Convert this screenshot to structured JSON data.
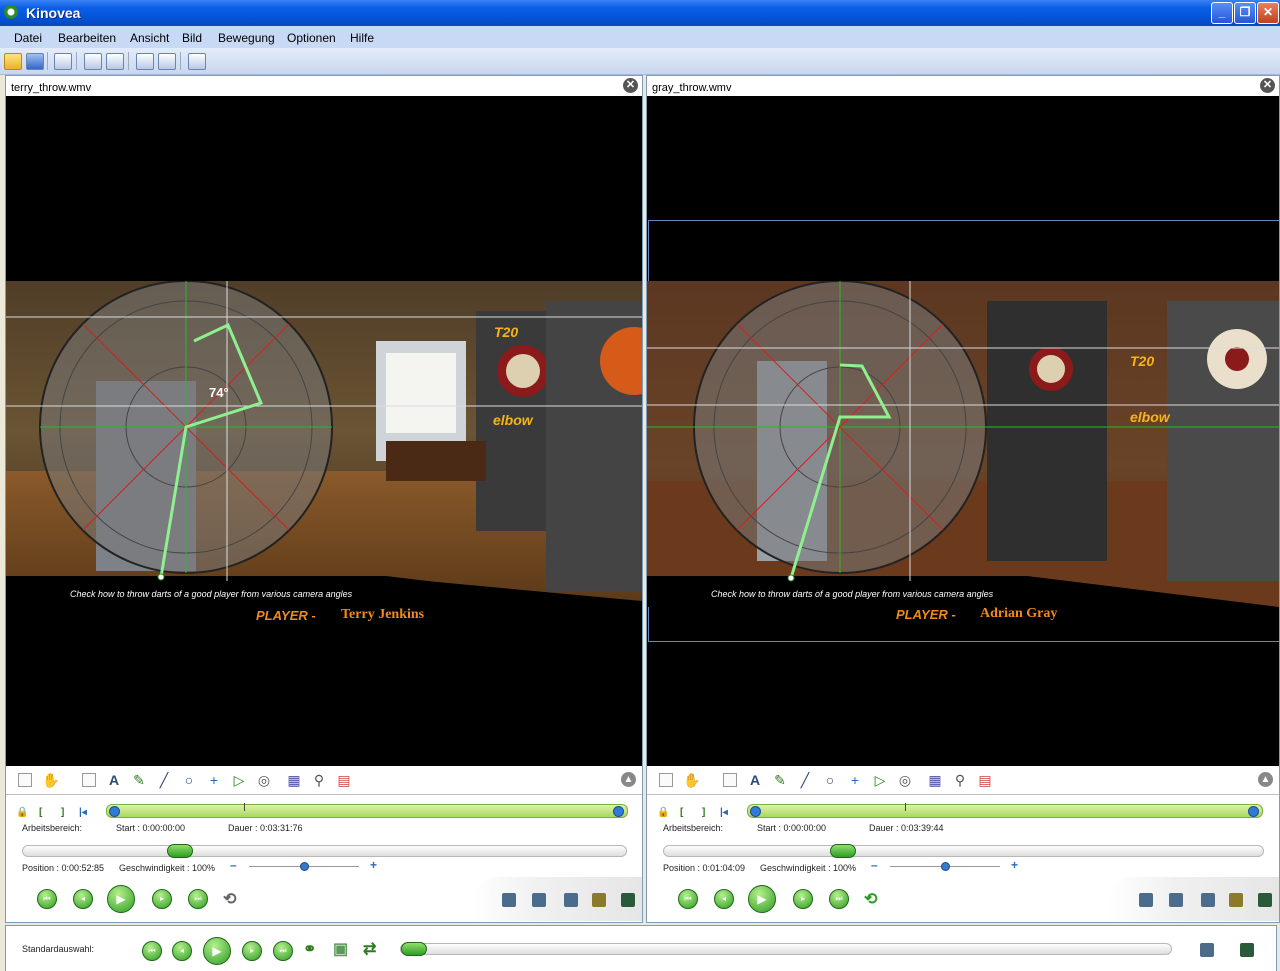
{
  "window": {
    "title": "Kinovea",
    "min_label": "_",
    "max_label": "❐",
    "close_label": "✕"
  },
  "menu": [
    "Datei",
    "Bearbeiten",
    "Ansicht",
    "Bild",
    "Bewegung",
    "Optionen",
    "Hilfe"
  ],
  "toolbar_icons": [
    "open-folder-icon",
    "save-icon",
    "browser-icon",
    "single-player-icon",
    "dual-player-icon",
    "capture-icon",
    "dual-capture-icon",
    "swap-screens-icon"
  ],
  "players": [
    {
      "file_name": "terry_throw.wmv",
      "close_label": "✕",
      "video": {
        "caption": "Check how to throw darts of a good  player from various camera angles",
        "player_prefix": "PLAYER -",
        "player_name": "Terry Jenkins",
        "angle_label": "74°",
        "t20_label": "T20",
        "elbow_label": "elbow"
      },
      "workspace_label": "Arbeitsbereich:",
      "start": "Start : 0:00:00:00",
      "duration": "Dauer : 0:03:31:76",
      "position": "Position : 0:00:52:85",
      "speed": "Geschwindigkeit : 100%",
      "loop_active": false
    },
    {
      "file_name": "gray_throw.wmv",
      "close_label": "✕",
      "video": {
        "caption": "Check how to throw darts of a good  player from various camera angles",
        "player_prefix": "PLAYER -",
        "player_name": "Adrian Gray",
        "angle_label": "",
        "t20_label": "T20",
        "elbow_label": "elbow"
      },
      "workspace_label": "Arbeitsbereich:",
      "start": "Start : 0:00:00:00",
      "duration": "Dauer : 0:03:39:44",
      "position": "Position : 0:01:04:09",
      "speed": "Geschwindigkeit : 100%",
      "loop_active": true
    }
  ],
  "drawing_tools": [
    "new-key-image-icon",
    "hand-tool-icon",
    "comment-icon",
    "text-tool-icon",
    "pencil-tool-icon",
    "line-tool-icon",
    "circle-tool-icon",
    "cross-marker-icon",
    "angle-tool-icon",
    "chrono-tool-icon",
    "grid-tool-icon",
    "magnifier-icon",
    "color-profile-icon"
  ],
  "common_controls": {
    "label": "Standardauswahl:"
  },
  "colors": {
    "accent_green": "#2f9c24",
    "timeline_green": "#a8d760",
    "title_blue": "#0453d8",
    "protractor_label": "#ffcc00"
  }
}
